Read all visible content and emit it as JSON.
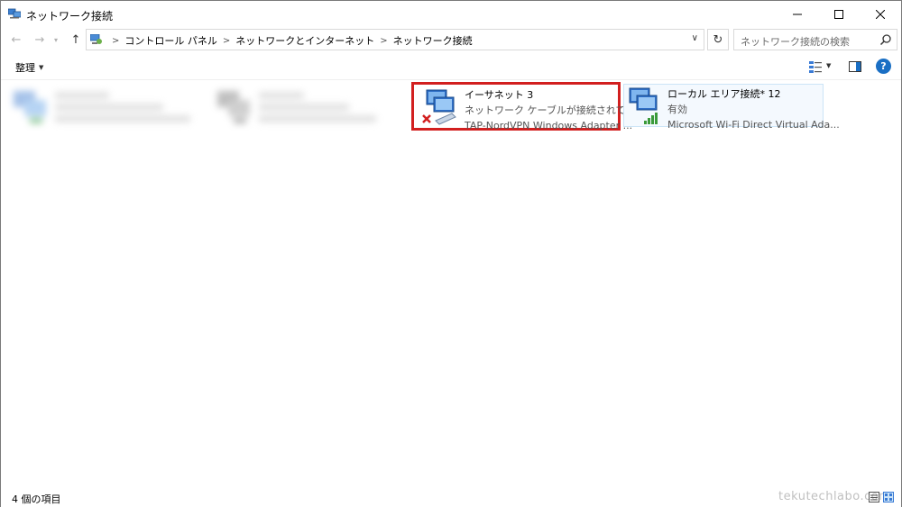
{
  "window": {
    "title": "ネットワーク接続",
    "icons": {
      "minimize": "minimize-icon",
      "maximize": "maximize-icon",
      "close": "close-icon"
    }
  },
  "address_bar": {
    "breadcrumbs": [
      "コントロール パネル",
      "ネットワークとインターネット",
      "ネットワーク接続"
    ],
    "search_placeholder": "ネットワーク接続の検索"
  },
  "toolbar": {
    "organize_label": "整理"
  },
  "connections": [
    {
      "name": "",
      "status": "",
      "device": "",
      "blurred": true
    },
    {
      "name": "",
      "status": "",
      "device": "",
      "blurred": true
    },
    {
      "name": "イーサネット 3",
      "status": "ネットワーク ケーブルが接続されていま...",
      "device": "TAP-NordVPN Windows Adapter ...",
      "state": "disconnected",
      "highlighted": true
    },
    {
      "name": "ローカル エリア接続* 12",
      "status": "有効",
      "device": "Microsoft Wi-Fi Direct Virtual Ada...",
      "state": "wireless",
      "selected": true
    }
  ],
  "statusbar": {
    "item_count": "4 個の項目",
    "watermark": "tekutechlabo.com"
  },
  "colors": {
    "highlight_border": "#d21f1f",
    "selection_bg": "#f4f9fe",
    "selection_border": "#cce4f7",
    "help_blue": "#1a6fc4"
  }
}
